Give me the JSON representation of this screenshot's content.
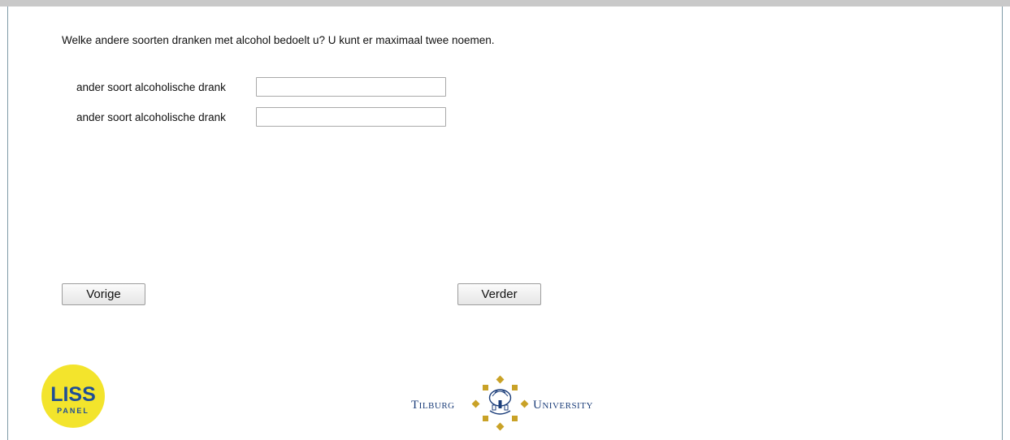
{
  "question": {
    "text": "Welke andere soorten dranken met alcohol bedoelt u? U kunt er maximaal twee noemen."
  },
  "fields": [
    {
      "label": "ander soort alcoholische drank",
      "value": ""
    },
    {
      "label": "ander soort alcoholische drank",
      "value": ""
    }
  ],
  "buttons": {
    "previous": "Vorige",
    "next": "Verder"
  },
  "logos": {
    "liss": {
      "line1": "LISS",
      "line2": "PANEL"
    },
    "university": {
      "left": "Tilburg",
      "right": "University"
    }
  },
  "colors": {
    "frame_border": "#7f9aa7",
    "liss_yellow": "#f3e42c",
    "liss_blue": "#1f4e96",
    "tilburg_gold": "#c9a227",
    "tilburg_blue": "#1c3e7a"
  }
}
